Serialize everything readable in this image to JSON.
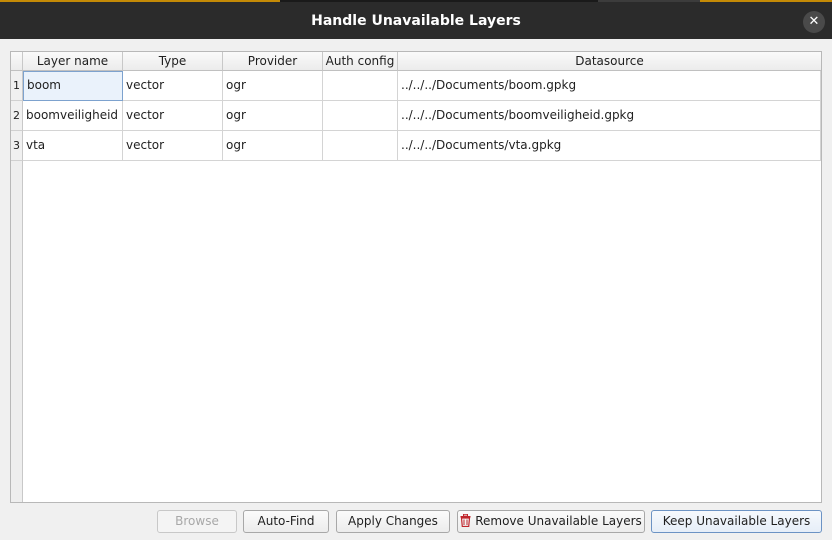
{
  "window": {
    "title": "Handle Unavailable Layers",
    "close_symbol": "✕"
  },
  "table": {
    "columns": [
      "Layer name",
      "Type",
      "Provider",
      "Auth config",
      "Datasource"
    ],
    "rows": [
      {
        "num": "1",
        "layer_name": "boom",
        "type": "vector",
        "provider": "ogr",
        "auth_config": "",
        "datasource": "../../../Documents/boom.gpkg"
      },
      {
        "num": "2",
        "layer_name": "boomveiligheid",
        "type": "vector",
        "provider": "ogr",
        "auth_config": "",
        "datasource": "../../../Documents/boomveiligheid.gpkg"
      },
      {
        "num": "3",
        "layer_name": "vta",
        "type": "vector",
        "provider": "ogr",
        "auth_config": "",
        "datasource": "../../../Documents/vta.gpkg"
      }
    ]
  },
  "buttons": {
    "browse": "Browse",
    "auto_find": "Auto-Find",
    "apply_changes": "Apply Changes",
    "remove_unavailable": "Remove Unavailable Layers",
    "keep_unavailable": "Keep Unavailable Layers"
  },
  "icons": {
    "close": "close-icon",
    "remove": "trash-icon"
  },
  "colors": {
    "titlebar": "#2b2b2b",
    "accent": "#c48a06",
    "selection": "#eaf2fb",
    "trash": "#c0262d"
  }
}
